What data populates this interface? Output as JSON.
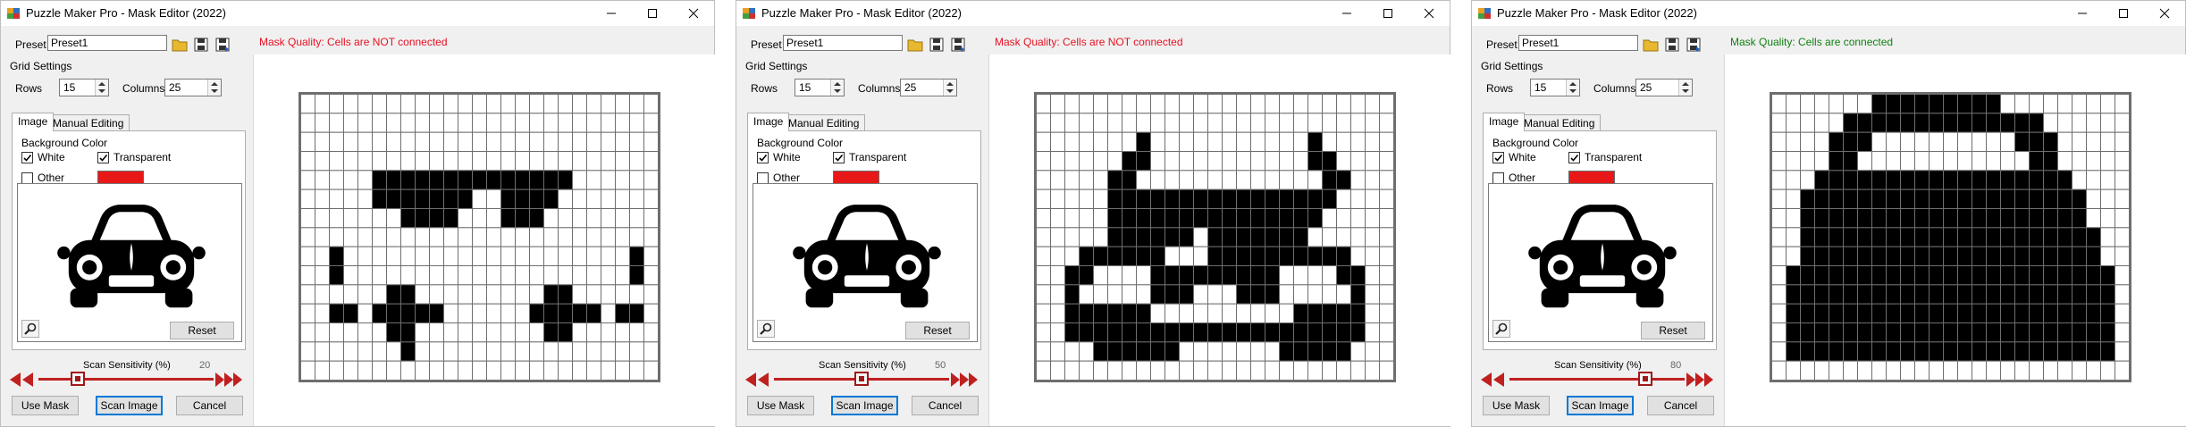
{
  "windows": [
    {
      "title": "Puzzle Maker Pro - Mask Editor (2022)",
      "preset_label": "Preset",
      "preset_value": "Preset1",
      "grid_settings_label": "Grid Settings",
      "rows_label": "Rows",
      "rows_value": "15",
      "columns_label": "Columns",
      "columns_value": "25",
      "mask_quality": "Mask Quality: Cells are NOT connected",
      "mask_quality_color": "#e81123",
      "tabs": [
        "Image",
        "Manual Editing"
      ],
      "background_color_label": "Background Color",
      "white_label": "White",
      "transparent_label": "Transparent",
      "other_label": "Other",
      "reset_label": "Reset",
      "scan_sensitivity_label": "Scan Sensitivity (%)",
      "scan_sensitivity_value": "20",
      "use_mask_label": "Use Mask",
      "scan_image_label": "Scan Image",
      "cancel_label": "Cancel",
      "mask": [
        "0000000000000000000000000",
        "0000000000000000000000000",
        "0000000000000000000000000",
        "0000000000000000000000000",
        "0000011111111111111000000",
        "0000011111110011110000000",
        "0000000111100011100000000",
        "0000000000000000000000000",
        "0010000000000000000000010",
        "0010000000000000000000010",
        "0000001100000000011000000",
        "0011011111000000111110110",
        "0000001100000000011000000",
        "0000000100000000000000000",
        "0000000000000000000000000"
      ]
    },
    {
      "title": "Puzzle Maker Pro - Mask Editor (2022)",
      "preset_label": "Preset",
      "preset_value": "Preset1",
      "grid_settings_label": "Grid Settings",
      "rows_label": "Rows",
      "rows_value": "15",
      "columns_label": "Columns",
      "columns_value": "25",
      "mask_quality": "Mask Quality: Cells are NOT connected",
      "mask_quality_color": "#e81123",
      "tabs": [
        "Image",
        "Manual Editing"
      ],
      "background_color_label": "Background Color",
      "white_label": "White",
      "transparent_label": "Transparent",
      "other_label": "Other",
      "reset_label": "Reset",
      "scan_sensitivity_label": "Scan Sensitivity (%)",
      "scan_sensitivity_value": "50",
      "use_mask_label": "Use Mask",
      "scan_image_label": "Scan Image",
      "cancel_label": "Cancel",
      "mask": [
        "0000000000000000000000000",
        "0000000000000000000000000",
        "0000000100000000000100000",
        "0000001100000000000110000",
        "0000011000000000000011000",
        "0000011111111111111110000",
        "0000011111111111111100000",
        "0000011111101111111000000",
        "0001111110001111111111000",
        "0011000011111111100001100",
        "0010000011100011100000100",
        "0011111100000000001111100",
        "0011111111111111111111100",
        "0000111111000000011111000",
        "0000000000000000000000000"
      ]
    },
    {
      "title": "Puzzle Maker Pro - Mask Editor (2022)",
      "preset_label": "Preset",
      "preset_value": "Preset1",
      "grid_settings_label": "Grid Settings",
      "rows_label": "Rows",
      "rows_value": "15",
      "columns_label": "Columns",
      "columns_value": "25",
      "mask_quality": "Mask Quality: Cells are connected",
      "mask_quality_color": "#108010",
      "tabs": [
        "Image",
        "Manual Editing"
      ],
      "background_color_label": "Background Color",
      "white_label": "White",
      "transparent_label": "Transparent",
      "other_label": "Other",
      "reset_label": "Reset",
      "scan_sensitivity_label": "Scan Sensitivity (%)",
      "scan_sensitivity_value": "80",
      "use_mask_label": "Use Mask",
      "scan_image_label": "Scan Image",
      "cancel_label": "Cancel",
      "mask": [
        "0000000111111111000000000",
        "0000011111111111111000000",
        "0000111000000000011100000",
        "0000110000000000001100000",
        "0001111111111111111110000",
        "0011111111111111111111000",
        "0011111111111111111111000",
        "0011111111111111111111100",
        "0011111111111111111111100",
        "0111111111111111111111110",
        "0111111111111111111111110",
        "0111111111111111111111110",
        "0111111111111111111111110",
        "0111111111111111111111110",
        "0000000000000000000000000"
      ]
    }
  ]
}
